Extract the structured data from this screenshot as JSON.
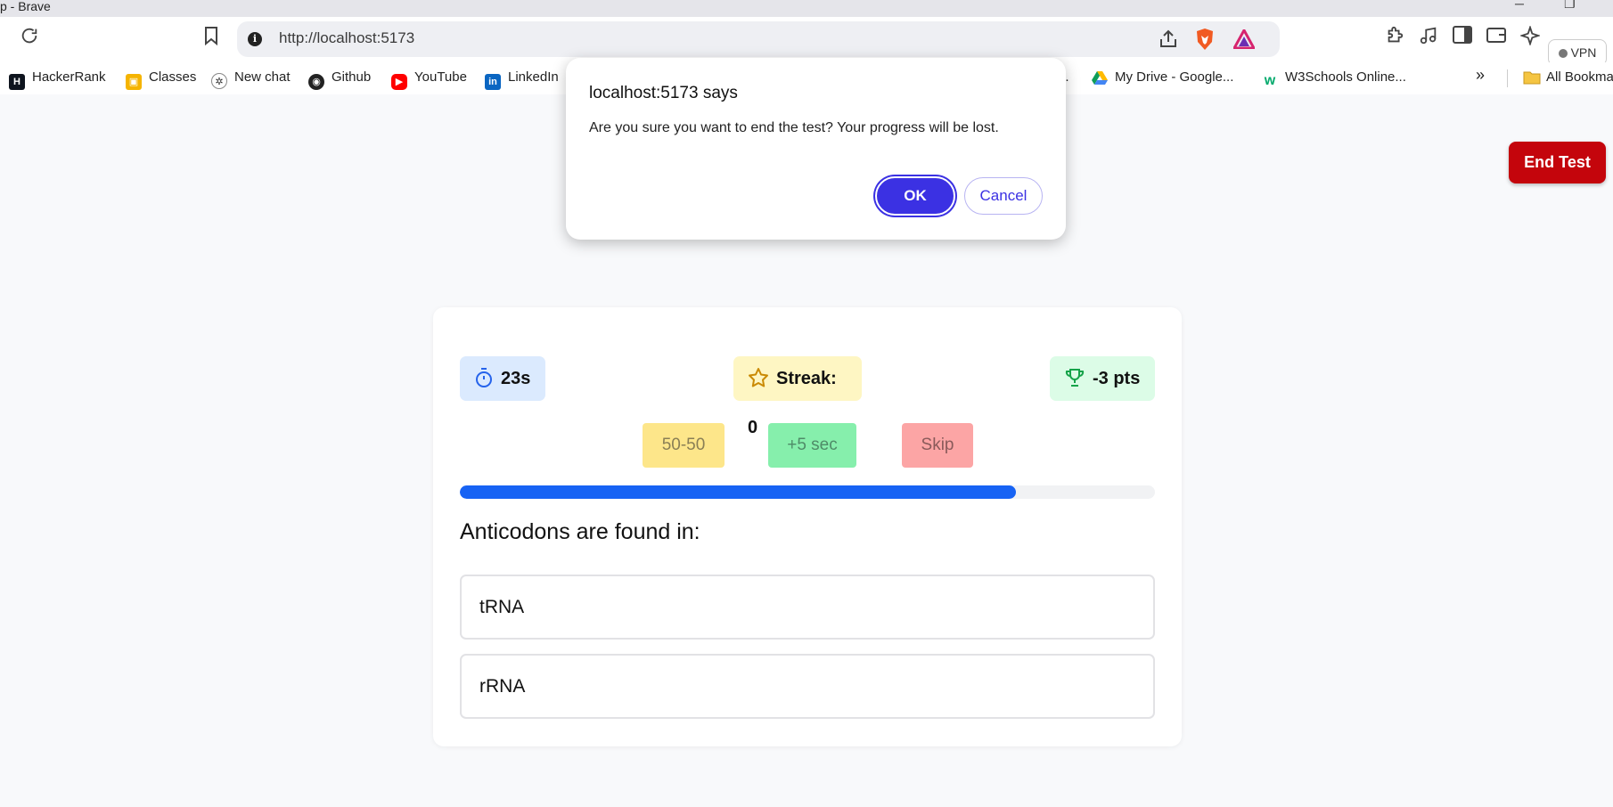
{
  "window": {
    "title": "p - Brave"
  },
  "toolbar": {
    "url": "http://localhost:5173",
    "vpn_label": "VPN"
  },
  "bookmarks": [
    {
      "label": "HackerRank",
      "icon": "hackerrank-icon"
    },
    {
      "label": "Classes",
      "icon": "classroom-icon"
    },
    {
      "label": "New chat",
      "icon": "chatgpt-icon"
    },
    {
      "label": "Github",
      "icon": "github-icon"
    },
    {
      "label": "YouTube",
      "icon": "youtube-icon"
    },
    {
      "label": "LinkedIn",
      "icon": "linkedin-icon"
    },
    {
      "label": "...",
      "icon": ""
    },
    {
      "label": "My Drive - Google...",
      "icon": "google-drive-icon"
    },
    {
      "label": "W3Schools Online...",
      "icon": "w3schools-icon"
    },
    {
      "label": "All Bookma",
      "icon": "folder-icon"
    }
  ],
  "dialog": {
    "title": "localhost:5173 says",
    "message": "Are you sure you want to end the test? Your progress will be lost.",
    "ok_label": "OK",
    "cancel_label": "Cancel"
  },
  "end_test_label": "End Test",
  "quiz": {
    "timer": "23s",
    "streak": "Streak: 0",
    "score": "-3 pts",
    "lifelines": {
      "fifty": "50-50",
      "time": "+5 sec",
      "skip": "Skip"
    },
    "progress_percent": 80,
    "question": "Anticodons are found in:",
    "options": [
      "tRNA",
      "rRNA"
    ]
  },
  "colors": {
    "accent": "#3b31e3",
    "end_test": "#c4050c",
    "progress": "#1763f4"
  }
}
